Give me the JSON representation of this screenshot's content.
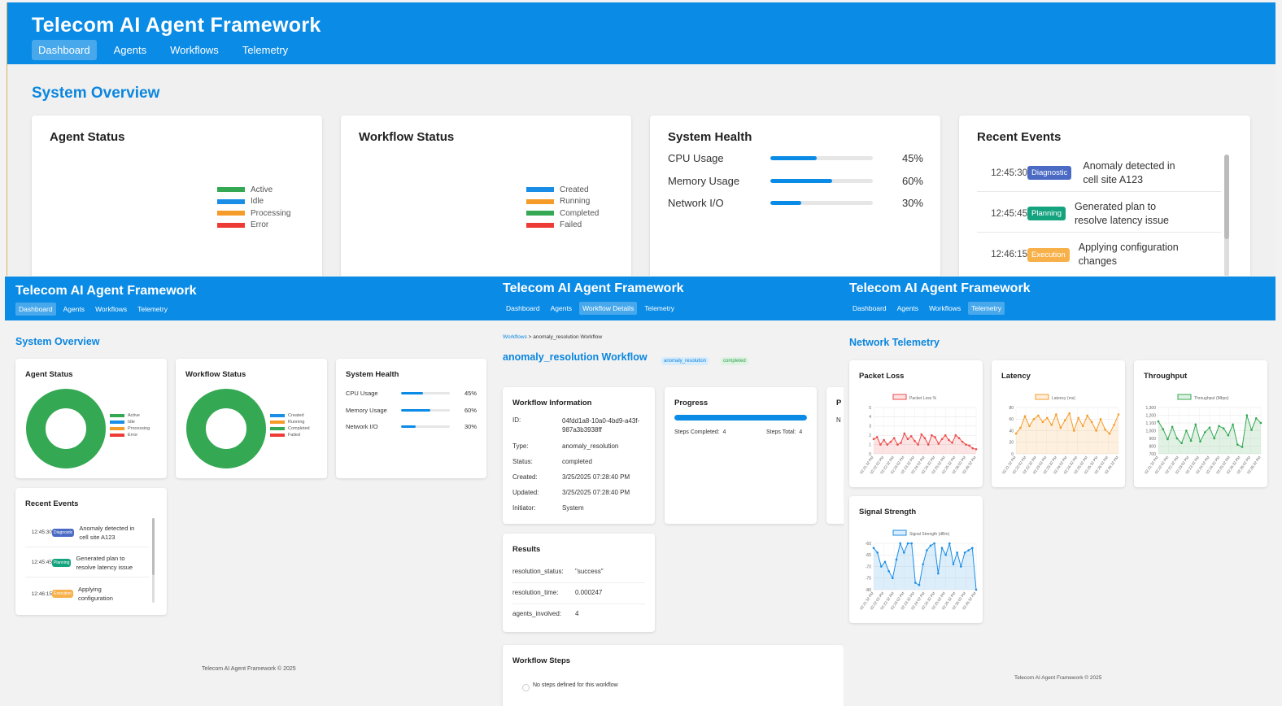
{
  "app_title": "Telecom AI Agent Framework",
  "colors": {
    "header": "#0a8be6",
    "active": "#34a853",
    "idle": "#1a8ee6",
    "processing": "#f59b2a",
    "error": "#ef3b36",
    "diagnostic": "#4a6ac4",
    "planning": "#14a37f",
    "execution": "#f7b04a"
  },
  "top": {
    "nav": [
      "Dashboard",
      "Agents",
      "Workflows",
      "Telemetry"
    ],
    "heading": "System Overview",
    "agent_status": {
      "title": "Agent Status",
      "legend": [
        "Active",
        "Idle",
        "Processing",
        "Error"
      ]
    },
    "workflow_status": {
      "title": "Workflow Status",
      "legend": [
        "Created",
        "Running",
        "Completed",
        "Failed"
      ]
    },
    "system_health": {
      "title": "System Health",
      "metrics": [
        {
          "label": "CPU Usage",
          "value": "45%",
          "fraction": 0.45
        },
        {
          "label": "Memory Usage",
          "value": "60%",
          "fraction": 0.6
        },
        {
          "label": "Network I/O",
          "value": "30%",
          "fraction": 0.3
        }
      ]
    },
    "recent_events": {
      "title": "Recent Events",
      "events": [
        {
          "time": "12:45:30",
          "type": "Diagnostic",
          "text1": "Anomaly detected in",
          "text2": "cell site A123"
        },
        {
          "time": "12:45:45",
          "type": "Planning",
          "text1": "Generated plan to",
          "text2": "resolve latency issue"
        },
        {
          "time": "12:46:15",
          "type": "Execution",
          "text1": "Applying configuration",
          "text2": "changes"
        }
      ]
    }
  },
  "dash": {
    "nav": [
      "Dashboard",
      "Agents",
      "Workflows",
      "Telemetry"
    ],
    "heading": "System Overview",
    "agent_status_title": "Agent Status",
    "agent_legend": [
      "Active",
      "Idle",
      "Processing",
      "Error"
    ],
    "workflow_status_title": "Workflow Status",
    "workflow_legend": [
      "Created",
      "Running",
      "Completed",
      "Failed"
    ],
    "system_health_title": "System Health",
    "metrics": [
      {
        "label": "CPU Usage",
        "value": "45%",
        "fraction": 0.45
      },
      {
        "label": "Memory Usage",
        "value": "60%",
        "fraction": 0.6
      },
      {
        "label": "Network I/O",
        "value": "30%",
        "fraction": 0.3
      }
    ],
    "recent_events_title": "Recent Events",
    "events": [
      {
        "time": "12:45:30",
        "type": "Diagnostic",
        "text1": "Anomaly detected in",
        "text2": "cell site A123"
      },
      {
        "time": "12:45:45",
        "type": "Planning",
        "text1": "Generated plan to",
        "text2": "resolve latency issue"
      },
      {
        "time": "12:46:15",
        "type": "Execution",
        "text1": "Applying",
        "text2": "configuration"
      }
    ],
    "footer": "Telecom AI Agent Framework © 2025"
  },
  "workflow": {
    "nav": [
      "Dashboard",
      "Agents",
      "Workflow Details",
      "Telemetry"
    ],
    "breadcrumb_link": "Workflows",
    "breadcrumb_rest": " > anomaly_resolution Workflow",
    "heading": "anomaly_resolution Workflow",
    "type_badge": "anomaly_resolution",
    "status_badge": "completed",
    "info_title": "Workflow Information",
    "info": [
      {
        "k": "ID:",
        "v1": "04fdd1a8-10a0-4bd9-a43f-",
        "v2": "987a3b3938ff"
      },
      {
        "k": "Type:",
        "v1": "anomaly_resolution",
        "v2": ""
      },
      {
        "k": "Status:",
        "v1": "completed",
        "v2": ""
      },
      {
        "k": "Created:",
        "v1": "3/25/2025 07:28:40 PM",
        "v2": ""
      },
      {
        "k": "Updated:",
        "v1": "3/25/2025 07:28:40 PM",
        "v2": ""
      },
      {
        "k": "Initiator:",
        "v1": "System",
        "v2": ""
      }
    ],
    "progress_title": "Progress",
    "progress_fraction": 1.0,
    "steps_completed_label": "Steps Completed:",
    "steps_completed": "4",
    "steps_total_label": "Steps Total:",
    "steps_total": "4",
    "cut_card_title": "P",
    "cut_card_text": "N",
    "results_title": "Results",
    "results": [
      {
        "k": "resolution_status:",
        "v": "\"success\""
      },
      {
        "k": "resolution_time:",
        "v": "0.000247"
      },
      {
        "k": "agents_involved:",
        "v": "4"
      }
    ],
    "steps_title": "Workflow Steps",
    "no_steps": "No steps defined for this workflow"
  },
  "telemetry": {
    "nav": [
      "Dashboard",
      "Agents",
      "Workflows",
      "Telemetry"
    ],
    "heading": "Network Telemetry",
    "footer": "Telecom AI Agent Framework © 2025",
    "time_labels": [
      "02:21:32 PM",
      "02:22:02 PM",
      "02:22:32 PM",
      "02:23:02 PM",
      "02:23:32 PM",
      "02:24:02 PM",
      "02:24:32 PM",
      "02:25:02 PM",
      "02:25:32 PM",
      "02:26:02 PM",
      "02:26:32 PM",
      "02:27:02 PM",
      "02:27:32 PM",
      "02:28:02 PM",
      "02:28:32 PM",
      "02:29:02 PM",
      "02:29:32 PM",
      "02:30:02 PM"
    ],
    "charts": [
      {
        "id": "packet",
        "title": "Packet Loss",
        "legend": "Packet Loss %",
        "color": "#ef4a4a",
        "fill": "rgba(239,74,74,0.15)",
        "ylim": [
          0,
          5
        ],
        "ticks": [
          0,
          1,
          2,
          3,
          4,
          5
        ],
        "values": [
          1.6,
          1.8,
          1.0,
          1.5,
          1.0,
          1.3,
          1.7,
          1.0,
          1.2,
          2.2,
          1.6,
          1.9,
          1.4,
          1.0,
          2.1,
          1.7,
          1.0,
          2.0,
          1.8,
          1.1,
          1.6,
          2.0,
          1.5,
          1.2,
          2.0,
          1.7,
          1.3,
          1.0,
          0.9,
          0.6,
          0.5
        ]
      },
      {
        "id": "latency",
        "title": "Latency",
        "legend": "Latency (ms)",
        "color": "#f59b2a",
        "fill": "rgba(245,155,42,0.15)",
        "ylim": [
          0,
          80
        ],
        "ticks": [
          0,
          20,
          40,
          60,
          80
        ],
        "values": [
          35,
          45,
          65,
          48,
          60,
          66,
          55,
          62,
          50,
          68,
          45,
          58,
          70,
          40,
          62,
          48,
          66,
          55,
          40,
          60,
          42,
          35,
          50,
          68
        ]
      },
      {
        "id": "throughput",
        "title": "Throughput",
        "legend": "Throughput (Mbps)",
        "color": "#34a853",
        "fill": "rgba(52,168,83,0.15)",
        "ylim": [
          700,
          1300
        ],
        "ticks": [
          700,
          800,
          900,
          1000,
          1100,
          1200,
          1300
        ],
        "values": [
          1120,
          1020,
          890,
          1050,
          900,
          840,
          1000,
          870,
          1080,
          860,
          980,
          1040,
          900,
          1060,
          1030,
          940,
          1080,
          820,
          790,
          1200,
          1010,
          1160,
          1100
        ]
      },
      {
        "id": "signal",
        "title": "Signal Strength",
        "legend": "Signal Strength (dBm)",
        "color": "#1a8ee6",
        "fill": "rgba(26,142,230,0.15)",
        "ylim": [
          -80,
          -60
        ],
        "ticks": [
          -80,
          -75,
          -70,
          -65,
          -60
        ],
        "values": [
          -62,
          -64,
          -70,
          -68,
          -72,
          -75,
          -67,
          -60,
          -64,
          -60,
          -60,
          -77,
          -78,
          -69,
          -63,
          -61,
          -60,
          -73,
          -62,
          -65,
          -60,
          -69,
          -64,
          -70,
          -64,
          -63,
          -62,
          -80
        ]
      }
    ]
  }
}
